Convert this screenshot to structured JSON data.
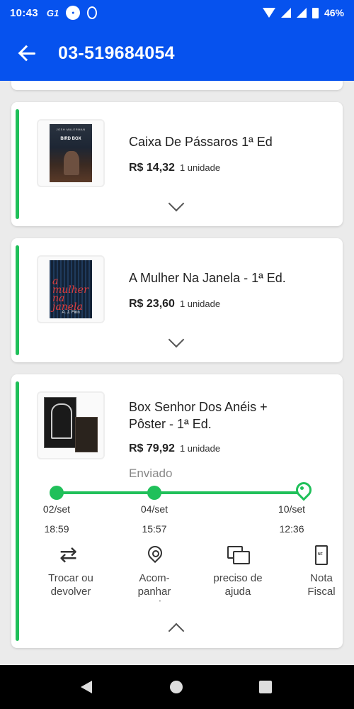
{
  "status_bar": {
    "time": "10:43",
    "g1_label": "G1",
    "battery": "46%"
  },
  "header": {
    "order_number": "03-519684054"
  },
  "items": [
    {
      "title": "Caixa De Pássaros 1ª Ed",
      "price": "R$ 14,32",
      "quantity": "1 unidade",
      "cover": {
        "title": "BIRD BOX",
        "author": "JOSH MALERMAN"
      }
    },
    {
      "title": "A Mulher Na Janela - 1ª Ed.",
      "price": "R$ 23,60",
      "quantity": "1 unidade",
      "cover": {
        "title": "a mulher na janela",
        "author": "A. J. Finn"
      }
    },
    {
      "title": "Box Senhor Dos Anéis + Pôster - 1ª Ed.",
      "price": "R$ 79,92",
      "quantity": "1 unidade",
      "status": "Enviado",
      "tracking": [
        {
          "date": "02/set",
          "time": "18:59"
        },
        {
          "date": "04/set",
          "time": "15:57"
        },
        {
          "date": "10/set",
          "time": "12:36"
        }
      ],
      "actions": [
        {
          "label": "Trocar ou devolver",
          "icon": "swap-icon"
        },
        {
          "label": "Acom- panhar envio",
          "icon": "location-icon"
        },
        {
          "label": "preciso de ajuda",
          "icon": "chat-icon"
        },
        {
          "label": "Nota Fiscal",
          "icon": "document-icon"
        }
      ]
    }
  ],
  "colors": {
    "primary": "#0652ee",
    "success": "#20c05a"
  }
}
